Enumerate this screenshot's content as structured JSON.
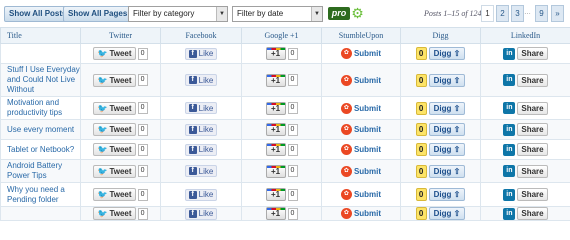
{
  "toolbar": {
    "show_all_posts": "Show All Posts",
    "show_all_pages": "Show All Pages",
    "category_filter": "Filter by category",
    "date_filter": "Filter by date",
    "pro_logo": "pro",
    "posts_count": "Posts 1–15 of 124",
    "pages": [
      "1",
      "2",
      "3",
      "9",
      "»"
    ],
    "ellipsis": "…"
  },
  "columns": [
    "Title",
    "Twitter",
    "Facebook",
    "Google +1",
    "StumbleUpon",
    "Digg",
    "LinkedIn"
  ],
  "buttons": {
    "tweet": "Tweet",
    "like": "Like",
    "plus_one": "+1",
    "submit": "Submit",
    "digg": "Digg ⇧",
    "share": "Share",
    "in": "in",
    "f": "f"
  },
  "rows": [
    {
      "title": "",
      "tweets": "0",
      "plus": "0",
      "digg": "0"
    },
    {
      "title": "Stuff I Use Everyday and Could Not Live Without",
      "tweets": "0",
      "plus": "0",
      "digg": "0"
    },
    {
      "title": "Motivation and productivity tips",
      "tweets": "0",
      "plus": "0",
      "digg": "0"
    },
    {
      "title": "Use every moment",
      "tweets": "0",
      "plus": "0",
      "digg": "0"
    },
    {
      "title": "Tablet or Netbook?",
      "tweets": "0",
      "plus": "0",
      "digg": "0"
    },
    {
      "title": "Android Battery Power Tips",
      "tweets": "0",
      "plus": "0",
      "digg": "0"
    },
    {
      "title": "Why you need a Pending folder",
      "tweets": "0",
      "plus": "0",
      "digg": "0"
    },
    {
      "title": "",
      "tweets": "0",
      "plus": "0",
      "digg": "0"
    }
  ],
  "colors": {
    "accent": "#2a5a8a",
    "digg_yellow": "#fde467",
    "stumble_red": "#eb4823",
    "linkedin": "#0e76a8",
    "facebook": "#3b5998"
  }
}
